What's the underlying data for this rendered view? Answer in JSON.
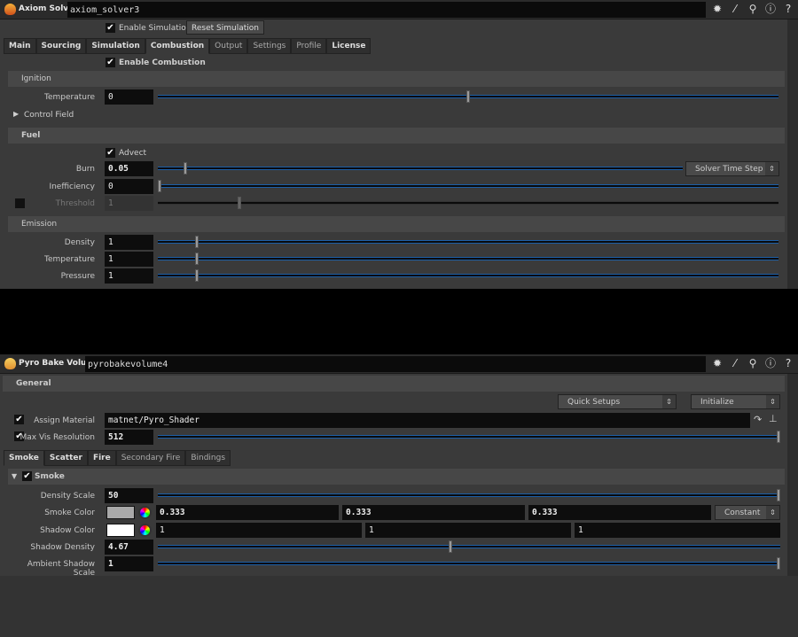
{
  "axiom": {
    "type_label": "Axiom Solver",
    "node_name": "axiom_solver3",
    "enable_simulation": "Enable Simulation",
    "reset_simulation": "Reset Simulation",
    "tabs": [
      "Main",
      "Sourcing",
      "Simulation",
      "Combustion",
      "Output",
      "Settings",
      "Profile",
      "License"
    ],
    "active_tab": "Combustion",
    "enable_combustion": "Enable Combustion",
    "ignition": {
      "title": "Ignition",
      "temperature_label": "Temperature",
      "temperature": "0",
      "temperature_slider": 0.5,
      "control_field": "Control Field"
    },
    "fuel": {
      "title": "Fuel",
      "advect": "Advect",
      "burn_label": "Burn",
      "burn": "0.05",
      "burn_slider": 0.05,
      "burn_mode": "Solver Time Step",
      "inefficiency_label": "Inefficiency",
      "inefficiency": "0",
      "inefficiency_slider": 0,
      "threshold_label": "Threshold",
      "threshold": "1",
      "threshold_slider": 0.13
    },
    "emission": {
      "title": "Emission",
      "density_label": "Density",
      "density": "1",
      "temperature_label": "Temperature",
      "temperature": "1",
      "pressure_label": "Pressure",
      "pressure": "1",
      "slider": 0.06
    }
  },
  "pyro": {
    "type_label": "Pyro Bake Volume",
    "node_name": "pyrobakevolume4",
    "general": "General",
    "quick_setups": "Quick Setups",
    "initialize": "Initialize",
    "assign_material_label": "Assign Material",
    "assign_material": "matnet/Pyro_Shader",
    "max_vis_label": "Max Vis Resolution",
    "max_vis": "512",
    "max_vis_slider": 1,
    "tabs": [
      "Smoke",
      "Scatter",
      "Fire",
      "Secondary Fire",
      "Bindings"
    ],
    "active_tab": "Smoke",
    "smoke": {
      "title": "Smoke",
      "density_scale_label": "Density Scale",
      "density_scale": "50",
      "density_scale_slider": 1,
      "smoke_color_label": "Smoke Color",
      "smoke_color": [
        "0.333",
        "0.333",
        "0.333"
      ],
      "smoke_color_mode": "Constant",
      "smoke_swatch": "#a9a9a9",
      "shadow_color_label": "Shadow Color",
      "shadow_color": [
        "1",
        "1",
        "1"
      ],
      "shadow_swatch": "#ffffff",
      "shadow_density_label": "Shadow Density",
      "shadow_density": "4.67",
      "shadow_density_slider": 0.47,
      "ambient_label": "Ambient Shadow Scale",
      "ambient": "1",
      "ambient_slider": 1
    }
  }
}
